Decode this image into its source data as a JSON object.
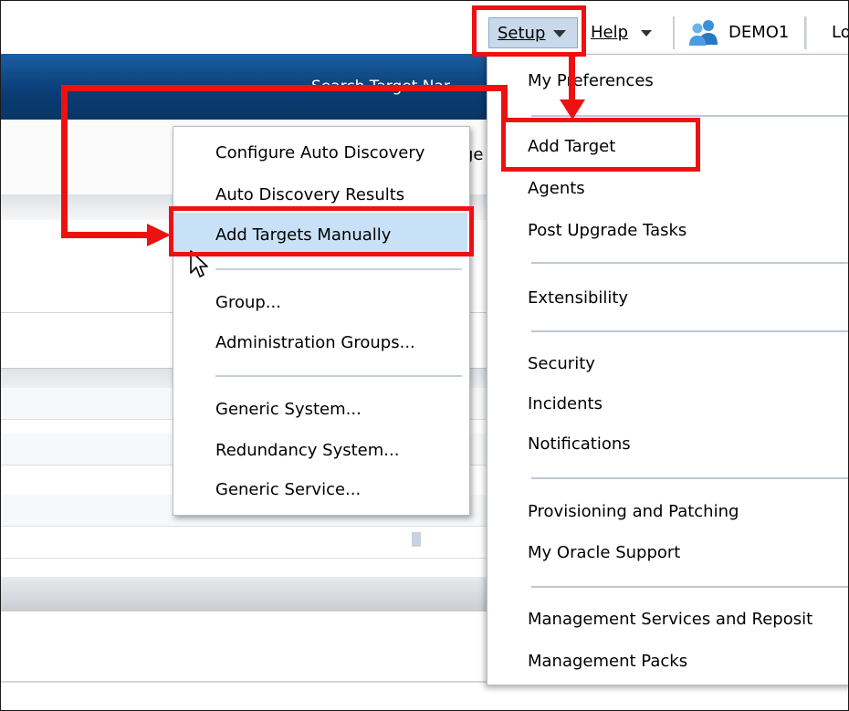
{
  "header": {
    "setup_label": "Setup",
    "help_label": "Help",
    "user_name": "DEMO1",
    "logout_fragment": "Lo"
  },
  "nav": {
    "search_label": "Search Target Nar"
  },
  "background": {
    "fragment": "ge"
  },
  "setup_menu": {
    "items": [
      "My Preferences",
      "Add Target",
      "Agents",
      "Post Upgrade Tasks",
      "Extensibility",
      "Security",
      "Incidents",
      "Notifications",
      "Provisioning and Patching",
      "My Oracle Support",
      "Management Services and Reposit",
      "Management Packs"
    ]
  },
  "add_target_submenu": {
    "items": [
      "Configure Auto Discovery",
      "Auto Discovery Results",
      "Add Targets Manually",
      "Group...",
      "Administration Groups...",
      "Generic System...",
      "Redundancy System...",
      "Generic Service..."
    ],
    "highlighted": "Add Targets Manually"
  },
  "colors": {
    "annotation_red": "#ee1111",
    "nav_blue": "#0a3c74",
    "highlight": "#c8e1f7"
  },
  "icons": [
    "user-group-icon",
    "mouse-pointer-icon",
    "dropdown-caret-icon"
  ]
}
